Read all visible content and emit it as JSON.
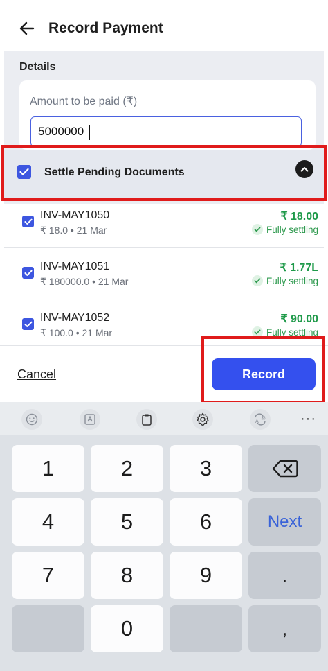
{
  "header": {
    "title": "Record Payment",
    "back_icon": "arrow-left-icon"
  },
  "details": {
    "section_title": "Details",
    "amount_label": "Amount to be paid (₹)",
    "amount_value": "5000000"
  },
  "settle": {
    "label": "Settle Pending Documents",
    "checked": true
  },
  "documents": [
    {
      "name": "INV-MAY1050",
      "meta": "₹ 18.0 • 21 Mar",
      "amount": "₹ 18.00",
      "status": "Fully settling",
      "checked": true
    },
    {
      "name": "INV-MAY1051",
      "meta": "₹ 180000.0 • 21 Mar",
      "amount": "₹ 1.77L",
      "status": "Fully settling",
      "checked": true
    },
    {
      "name": "INV-MAY1052",
      "meta": "₹ 100.0 • 21 Mar",
      "amount": "₹ 90.00",
      "status": "Fully settling",
      "checked": true
    }
  ],
  "footer": {
    "cancel_label": "Cancel",
    "record_label": "Record"
  },
  "keyboard": {
    "toolbar_icons": [
      "emoji-icon",
      "text-recognition-icon",
      "clipboard-icon",
      "settings-icon",
      "translate-icon",
      "more-icon"
    ],
    "more_label": "···",
    "keys": {
      "k1": "1",
      "k2": "2",
      "k3": "3",
      "k4": "4",
      "k5": "5",
      "k6": "6",
      "k7": "7",
      "k8": "8",
      "k9": "9",
      "k0": "0",
      "next": "Next",
      "dot": ".",
      "comma": ","
    }
  },
  "colors": {
    "accent": "#3450ee",
    "success": "#1f9a4a",
    "highlight": "#e01b1b"
  }
}
